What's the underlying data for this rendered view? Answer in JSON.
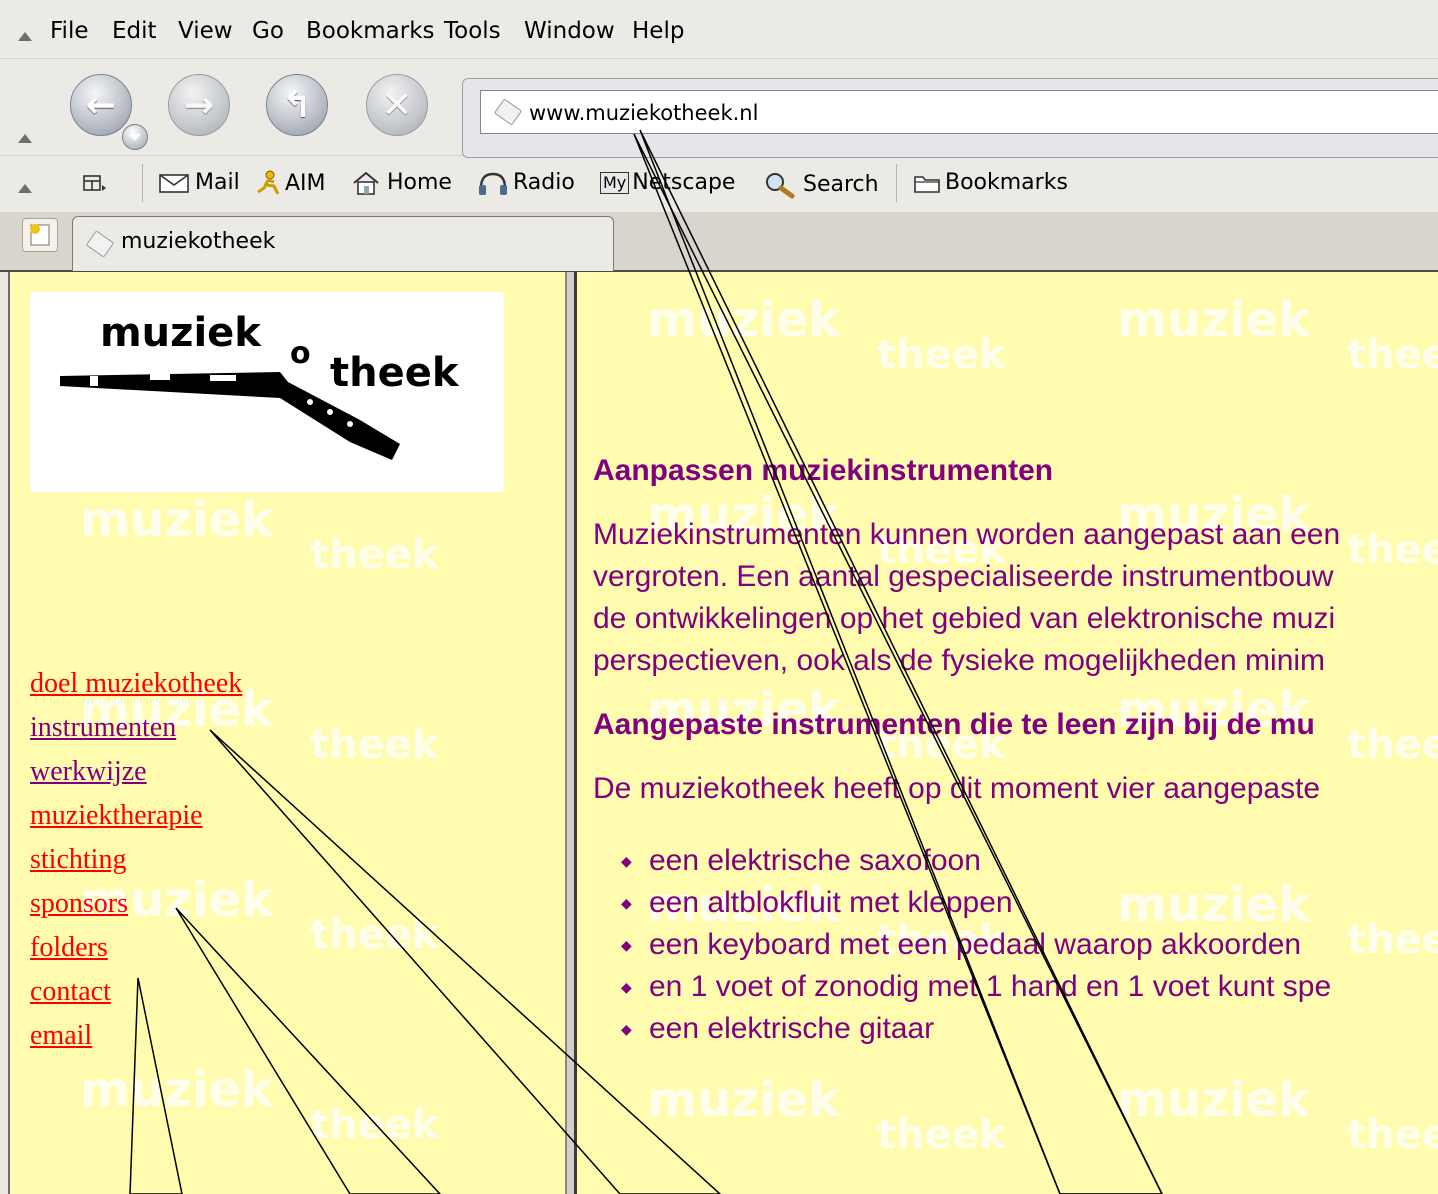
{
  "menu": {
    "items": [
      {
        "label": "File",
        "mnemonic": "F"
      },
      {
        "label": "Edit",
        "mnemonic": "E"
      },
      {
        "label": "View",
        "mnemonic": "V"
      },
      {
        "label": "Go",
        "mnemonic": "G"
      },
      {
        "label": "Bookmarks",
        "mnemonic": "B"
      },
      {
        "label": "Tools",
        "mnemonic": "T"
      },
      {
        "label": "Window",
        "mnemonic": "W"
      },
      {
        "label": "Help",
        "mnemonic": "H"
      }
    ]
  },
  "nav": {
    "url": "www.muziekotheek.nl"
  },
  "bookmarks_bar": {
    "mail": "Mail",
    "aim": "AIM",
    "home": "Home",
    "radio": "Radio",
    "my_badge": "My",
    "netscape": "Netscape",
    "search": "Search",
    "bookmarks": "Bookmarks"
  },
  "tab": {
    "title": "muziekotheek"
  },
  "logo": {
    "line1": "muziek",
    "line2": "o",
    "line3": "theek"
  },
  "watermark": {
    "word1": "muziek",
    "word2": "theek"
  },
  "sidebar_links": [
    {
      "label": "doel muziekotheek",
      "color": "#ff0000"
    },
    {
      "label": "instrumenten",
      "color": "#800080"
    },
    {
      "label": "werkwijze",
      "color": "#800080"
    },
    {
      "label": "muziektherapie",
      "color": "#ff0000"
    },
    {
      "label": "stichting",
      "color": "#ff0000"
    },
    {
      "label": "sponsors",
      "color": "#ff0000"
    },
    {
      "label": "folders",
      "color": "#ff0000"
    },
    {
      "label": "contact",
      "color": "#ff0000"
    },
    {
      "label": "email",
      "color": "#ff0000"
    }
  ],
  "content": {
    "heading1": "Aanpassen muziekinstrumenten",
    "para1_lines": [
      "Muziekinstrumenten kunnen worden aangepast aan een",
      "vergroten. Een aantal gespecialiseerde instrumentbouw",
      "de ontwikkelingen op het gebied van elektronische muzi",
      "perspectieven, ook als de fysieke mogelijkheden minim"
    ],
    "heading2": "Aangepaste instrumenten die te leen zijn bij de mu",
    "para2": "De muziekotheek heeft op dit moment vier aangepaste",
    "list": [
      "een elektrische saxofoon",
      "een altblokfluit met kleppen",
      "een keyboard met een pedaal waarop akkoorden",
      "en 1 voet of zonodig met 1 hand en 1 voet kunt spe",
      "een elektrische gitaar"
    ]
  },
  "colors": {
    "page_bg": "#fffcb0",
    "text_purple": "#800080",
    "link_red": "#ff0000",
    "link_visited": "#800080"
  }
}
